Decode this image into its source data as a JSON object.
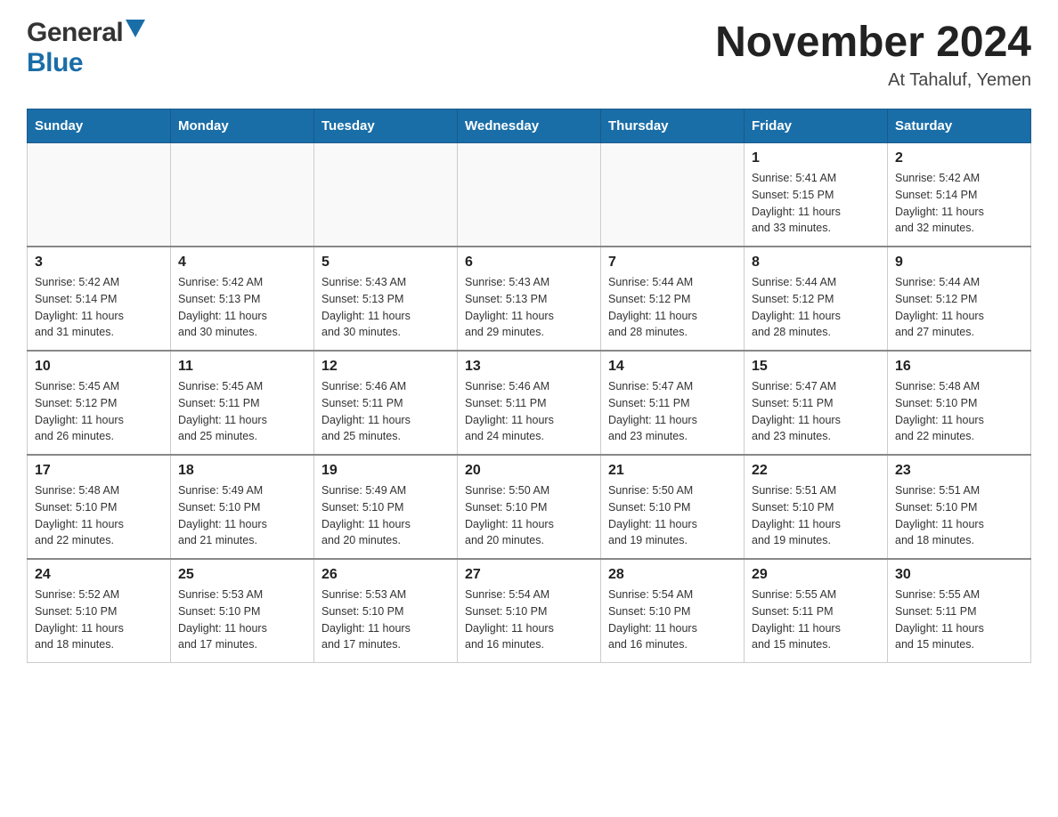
{
  "header": {
    "logo_general": "General",
    "logo_blue": "Blue",
    "month_title": "November 2024",
    "location": "At Tahaluf, Yemen"
  },
  "calendar": {
    "days_of_week": [
      "Sunday",
      "Monday",
      "Tuesday",
      "Wednesday",
      "Thursday",
      "Friday",
      "Saturday"
    ],
    "weeks": [
      {
        "days": [
          {
            "date": "",
            "info": ""
          },
          {
            "date": "",
            "info": ""
          },
          {
            "date": "",
            "info": ""
          },
          {
            "date": "",
            "info": ""
          },
          {
            "date": "",
            "info": ""
          },
          {
            "date": "1",
            "info": "Sunrise: 5:41 AM\nSunset: 5:15 PM\nDaylight: 11 hours\nand 33 minutes."
          },
          {
            "date": "2",
            "info": "Sunrise: 5:42 AM\nSunset: 5:14 PM\nDaylight: 11 hours\nand 32 minutes."
          }
        ]
      },
      {
        "days": [
          {
            "date": "3",
            "info": "Sunrise: 5:42 AM\nSunset: 5:14 PM\nDaylight: 11 hours\nand 31 minutes."
          },
          {
            "date": "4",
            "info": "Sunrise: 5:42 AM\nSunset: 5:13 PM\nDaylight: 11 hours\nand 30 minutes."
          },
          {
            "date": "5",
            "info": "Sunrise: 5:43 AM\nSunset: 5:13 PM\nDaylight: 11 hours\nand 30 minutes."
          },
          {
            "date": "6",
            "info": "Sunrise: 5:43 AM\nSunset: 5:13 PM\nDaylight: 11 hours\nand 29 minutes."
          },
          {
            "date": "7",
            "info": "Sunrise: 5:44 AM\nSunset: 5:12 PM\nDaylight: 11 hours\nand 28 minutes."
          },
          {
            "date": "8",
            "info": "Sunrise: 5:44 AM\nSunset: 5:12 PM\nDaylight: 11 hours\nand 28 minutes."
          },
          {
            "date": "9",
            "info": "Sunrise: 5:44 AM\nSunset: 5:12 PM\nDaylight: 11 hours\nand 27 minutes."
          }
        ]
      },
      {
        "days": [
          {
            "date": "10",
            "info": "Sunrise: 5:45 AM\nSunset: 5:12 PM\nDaylight: 11 hours\nand 26 minutes."
          },
          {
            "date": "11",
            "info": "Sunrise: 5:45 AM\nSunset: 5:11 PM\nDaylight: 11 hours\nand 25 minutes."
          },
          {
            "date": "12",
            "info": "Sunrise: 5:46 AM\nSunset: 5:11 PM\nDaylight: 11 hours\nand 25 minutes."
          },
          {
            "date": "13",
            "info": "Sunrise: 5:46 AM\nSunset: 5:11 PM\nDaylight: 11 hours\nand 24 minutes."
          },
          {
            "date": "14",
            "info": "Sunrise: 5:47 AM\nSunset: 5:11 PM\nDaylight: 11 hours\nand 23 minutes."
          },
          {
            "date": "15",
            "info": "Sunrise: 5:47 AM\nSunset: 5:11 PM\nDaylight: 11 hours\nand 23 minutes."
          },
          {
            "date": "16",
            "info": "Sunrise: 5:48 AM\nSunset: 5:10 PM\nDaylight: 11 hours\nand 22 minutes."
          }
        ]
      },
      {
        "days": [
          {
            "date": "17",
            "info": "Sunrise: 5:48 AM\nSunset: 5:10 PM\nDaylight: 11 hours\nand 22 minutes."
          },
          {
            "date": "18",
            "info": "Sunrise: 5:49 AM\nSunset: 5:10 PM\nDaylight: 11 hours\nand 21 minutes."
          },
          {
            "date": "19",
            "info": "Sunrise: 5:49 AM\nSunset: 5:10 PM\nDaylight: 11 hours\nand 20 minutes."
          },
          {
            "date": "20",
            "info": "Sunrise: 5:50 AM\nSunset: 5:10 PM\nDaylight: 11 hours\nand 20 minutes."
          },
          {
            "date": "21",
            "info": "Sunrise: 5:50 AM\nSunset: 5:10 PM\nDaylight: 11 hours\nand 19 minutes."
          },
          {
            "date": "22",
            "info": "Sunrise: 5:51 AM\nSunset: 5:10 PM\nDaylight: 11 hours\nand 19 minutes."
          },
          {
            "date": "23",
            "info": "Sunrise: 5:51 AM\nSunset: 5:10 PM\nDaylight: 11 hours\nand 18 minutes."
          }
        ]
      },
      {
        "days": [
          {
            "date": "24",
            "info": "Sunrise: 5:52 AM\nSunset: 5:10 PM\nDaylight: 11 hours\nand 18 minutes."
          },
          {
            "date": "25",
            "info": "Sunrise: 5:53 AM\nSunset: 5:10 PM\nDaylight: 11 hours\nand 17 minutes."
          },
          {
            "date": "26",
            "info": "Sunrise: 5:53 AM\nSunset: 5:10 PM\nDaylight: 11 hours\nand 17 minutes."
          },
          {
            "date": "27",
            "info": "Sunrise: 5:54 AM\nSunset: 5:10 PM\nDaylight: 11 hours\nand 16 minutes."
          },
          {
            "date": "28",
            "info": "Sunrise: 5:54 AM\nSunset: 5:10 PM\nDaylight: 11 hours\nand 16 minutes."
          },
          {
            "date": "29",
            "info": "Sunrise: 5:55 AM\nSunset: 5:11 PM\nDaylight: 11 hours\nand 15 minutes."
          },
          {
            "date": "30",
            "info": "Sunrise: 5:55 AM\nSunset: 5:11 PM\nDaylight: 11 hours\nand 15 minutes."
          }
        ]
      }
    ]
  }
}
